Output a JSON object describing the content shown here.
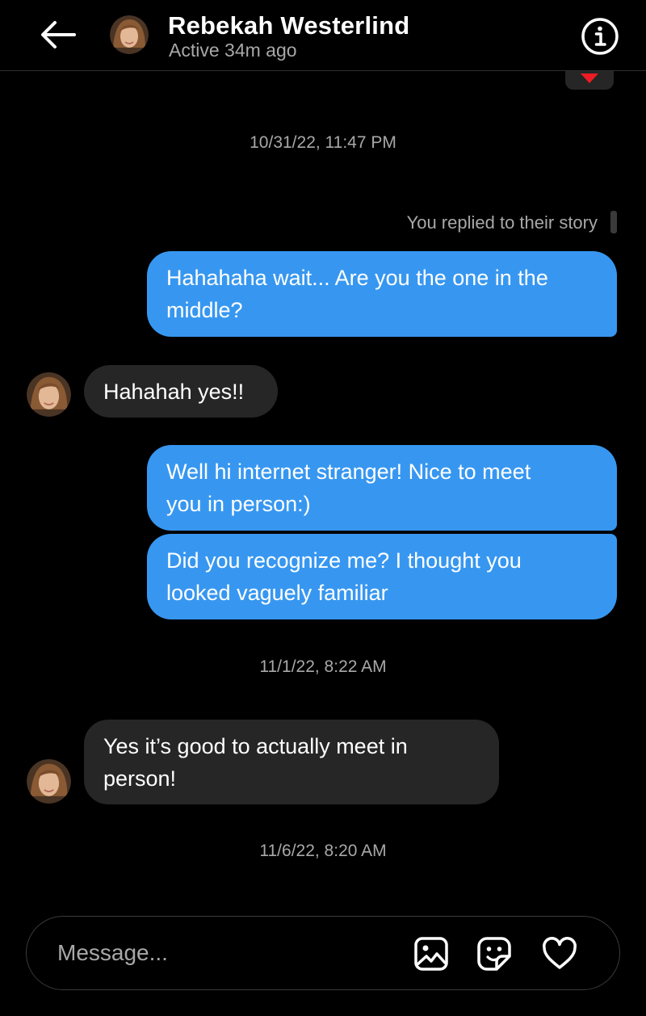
{
  "header": {
    "contact_name": "Rebekah Westerlind",
    "status": "Active 34m ago",
    "icons": {
      "back": "arrow-left-icon",
      "info": "info-icon",
      "avatar": "profile-photo"
    }
  },
  "reaction": {
    "emoji": "heart",
    "color": "#ed1c24"
  },
  "conversation": {
    "timestamps": [
      "10/31/22, 11:47 PM",
      "11/1/22, 8:22 AM",
      "11/6/22, 8:20 AM"
    ],
    "story_reply_note": "You replied to their story",
    "messages": [
      {
        "direction": "outgoing",
        "lines": [
          "Hahahaha wait... Are you the one in the",
          "middle?"
        ]
      },
      {
        "direction": "incoming",
        "lines": [
          "Hahahah yes!!"
        ]
      },
      {
        "direction": "outgoing",
        "lines": [
          "Well hi internet stranger! Nice to meet",
          "you in person:)"
        ]
      },
      {
        "direction": "outgoing",
        "lines": [
          "Did you recognize me? I thought you",
          "looked vaguely familiar"
        ]
      },
      {
        "direction": "incoming",
        "lines": [
          "Yes it’s good to actually meet in",
          "person!"
        ]
      }
    ]
  },
  "composer": {
    "placeholder": "Message...",
    "icons": [
      "image-icon",
      "sticker-icon",
      "heart-icon"
    ]
  },
  "colors": {
    "background": "#000000",
    "outgoing_bubble": "#3797f0",
    "incoming_bubble": "#262626",
    "secondary_text": "#a8a8a8"
  }
}
